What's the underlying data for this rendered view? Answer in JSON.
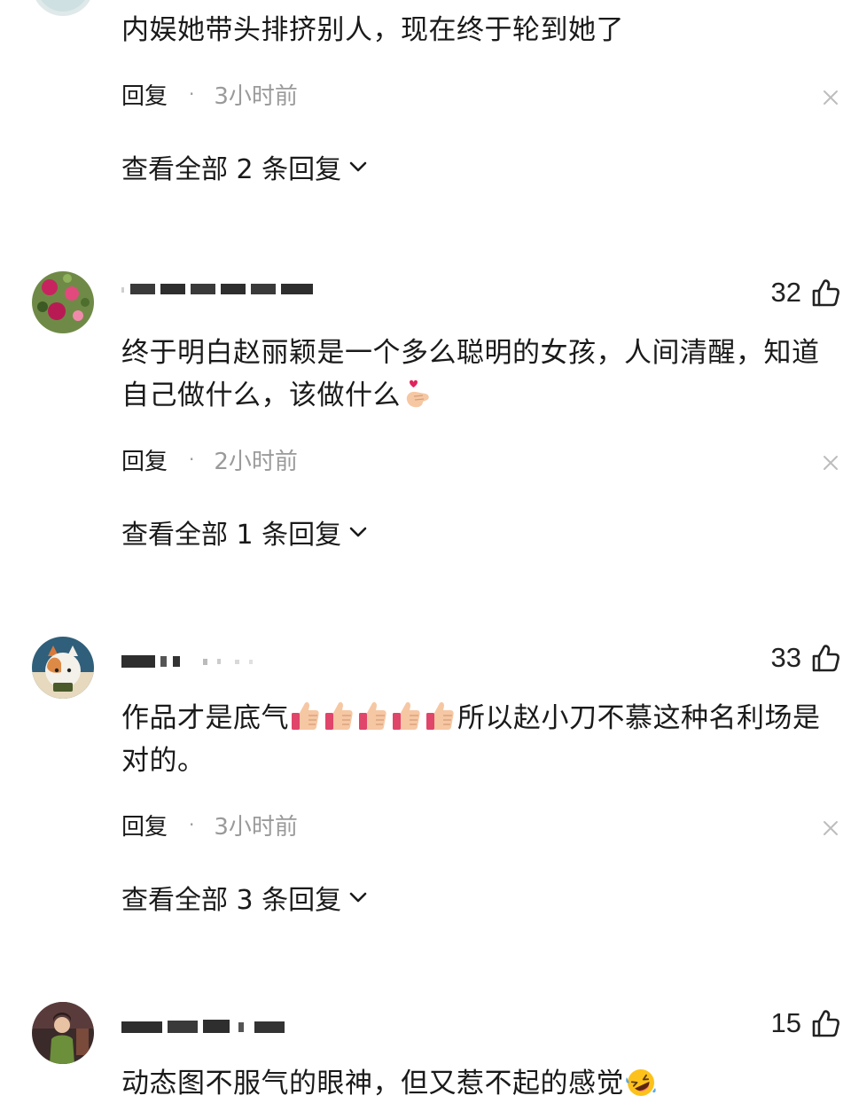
{
  "ui": {
    "reply_label": "回复",
    "dot": "·"
  },
  "comments": [
    {
      "text": "内娱她带头排挤别人，现在终于轮到她了",
      "time": "3小时前",
      "view_all": "查看全部 2 条回复"
    },
    {
      "likes": "32",
      "text": "终于明白赵丽颖是一个多么聪明的女孩，人间清醒，知道自己做什么，该做什么",
      "time": "2小时前",
      "view_all": "查看全部 1 条回复"
    },
    {
      "likes": "33",
      "text_a": "作品才是底气",
      "text_b": "所以赵小刀不慕这种名利场是对的。",
      "time": "3小时前",
      "view_all": "查看全部 3 条回复"
    },
    {
      "likes": "15",
      "text": "动态图不服气的眼神，但又惹不起的感觉"
    }
  ],
  "icons": {
    "like": "thumbs-up-outline-icon",
    "close": "close-icon",
    "expand": "chevron-down-icon",
    "emoji_heart_hand": "finger-heart-emoji",
    "emoji_thumb": "thumbs-up-emoji",
    "emoji_laugh": "rolling-laughing-emoji"
  },
  "colors": {
    "text": "#1a1a1a",
    "muted": "#9a9a9a",
    "background": "#ffffff"
  }
}
